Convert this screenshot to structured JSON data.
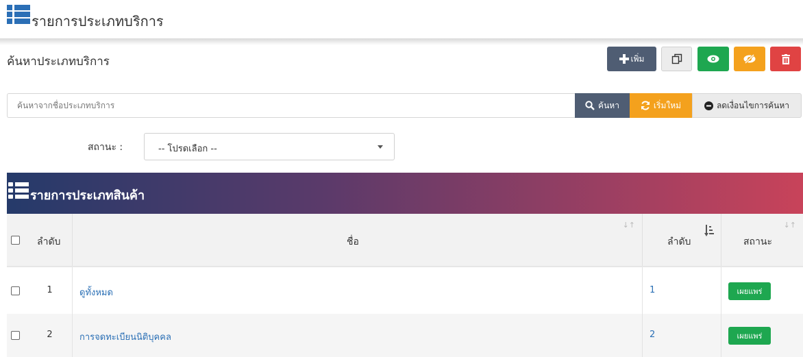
{
  "header": {
    "title": "รายการประเภทบริการ",
    "icon": "list-icon"
  },
  "search_section": {
    "title": "ค้นหาประเภทบริการ"
  },
  "actions": {
    "add_label": "เพิ่ม",
    "copy_icon": "copy-icon",
    "show_icon": "eye-icon",
    "hide_icon": "eye-slash-icon",
    "delete_icon": "trash-icon"
  },
  "search": {
    "placeholder": "ค้นหาจากชื่อประเภทบริการ",
    "search_label": "ค้นหา",
    "reset_label": "เริ่มใหม่",
    "reduce_label": "ลดเงื่อนไขการค้นหา"
  },
  "filter": {
    "status_label": "สถานะ :",
    "status_value": "-- โปรดเลือก --"
  },
  "panel": {
    "title": "รายการประเภทสินค้า",
    "icon": "list-icon"
  },
  "table": {
    "columns": {
      "no": "ลำดับ",
      "name": "ชื่อ",
      "order": "ลำดับ",
      "status": "สถานะ"
    },
    "rows": [
      {
        "no": "1",
        "name": "ดูทั้งหมด",
        "order": "1",
        "status": "เผยแพร่"
      },
      {
        "no": "2",
        "name": "การจดทะเบียนนิติบุคคล",
        "order": "2",
        "status": "เผยแพร่"
      }
    ]
  },
  "colors": {
    "primary_dark": "#4f5d73",
    "success": "#1ea750",
    "warning": "#f4a11d",
    "danger": "#e04343",
    "link": "#2a6fb5",
    "gradient_start": "#253a6a",
    "gradient_end": "#c8435a"
  }
}
